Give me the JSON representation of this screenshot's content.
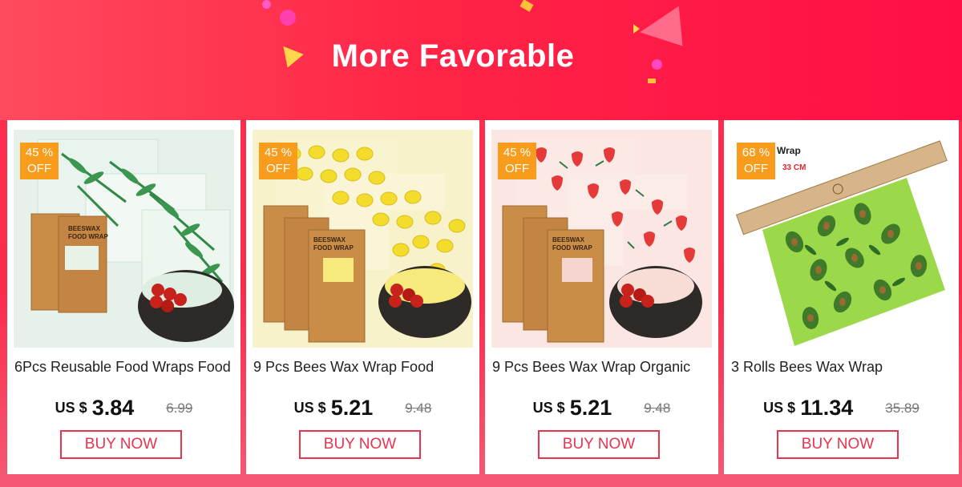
{
  "banner": {
    "title": "More Favorable"
  },
  "products": [
    {
      "badge_line1": "45 %",
      "badge_line2": "OFF",
      "name": "6Pcs Reusable Food Wraps Food",
      "currency": "US $",
      "price": "3.84",
      "old_price": "6.99",
      "button": "BUY NOW",
      "image": "leaf-print-beeswax-wraps"
    },
    {
      "badge_line1": "45 %",
      "badge_line2": "OFF",
      "name": "9 Pcs Bees Wax Wrap Food",
      "currency": "US $",
      "price": "5.21",
      "old_price": "9.48",
      "button": "BUY NOW",
      "image": "lemon-print-beeswax-wraps"
    },
    {
      "badge_line1": "45 %",
      "badge_line2": "OFF",
      "name": "9 Pcs Bees Wax Wrap Organic",
      "currency": "US $",
      "price": "5.21",
      "old_price": "9.48",
      "button": "BUY NOW",
      "image": "strawberry-print-beeswax-wraps"
    },
    {
      "badge_line1": "68 %",
      "badge_line2": "OFF",
      "name": "3 Rolls Bees Wax Wrap",
      "currency": "US $",
      "price": "11.34",
      "old_price": "35.89",
      "button": "BUY NOW",
      "image": "avocado-print-wax-roll"
    }
  ],
  "image_text": {
    "kraft_line1": "BEESWAX",
    "kraft_line2": "FOOD WRAP",
    "roll_label": "x Wrap",
    "roll_size": "33 CM"
  },
  "colors": {
    "accent": "#ff2446",
    "badge": "#f99c1c",
    "button": "#e8344e"
  }
}
